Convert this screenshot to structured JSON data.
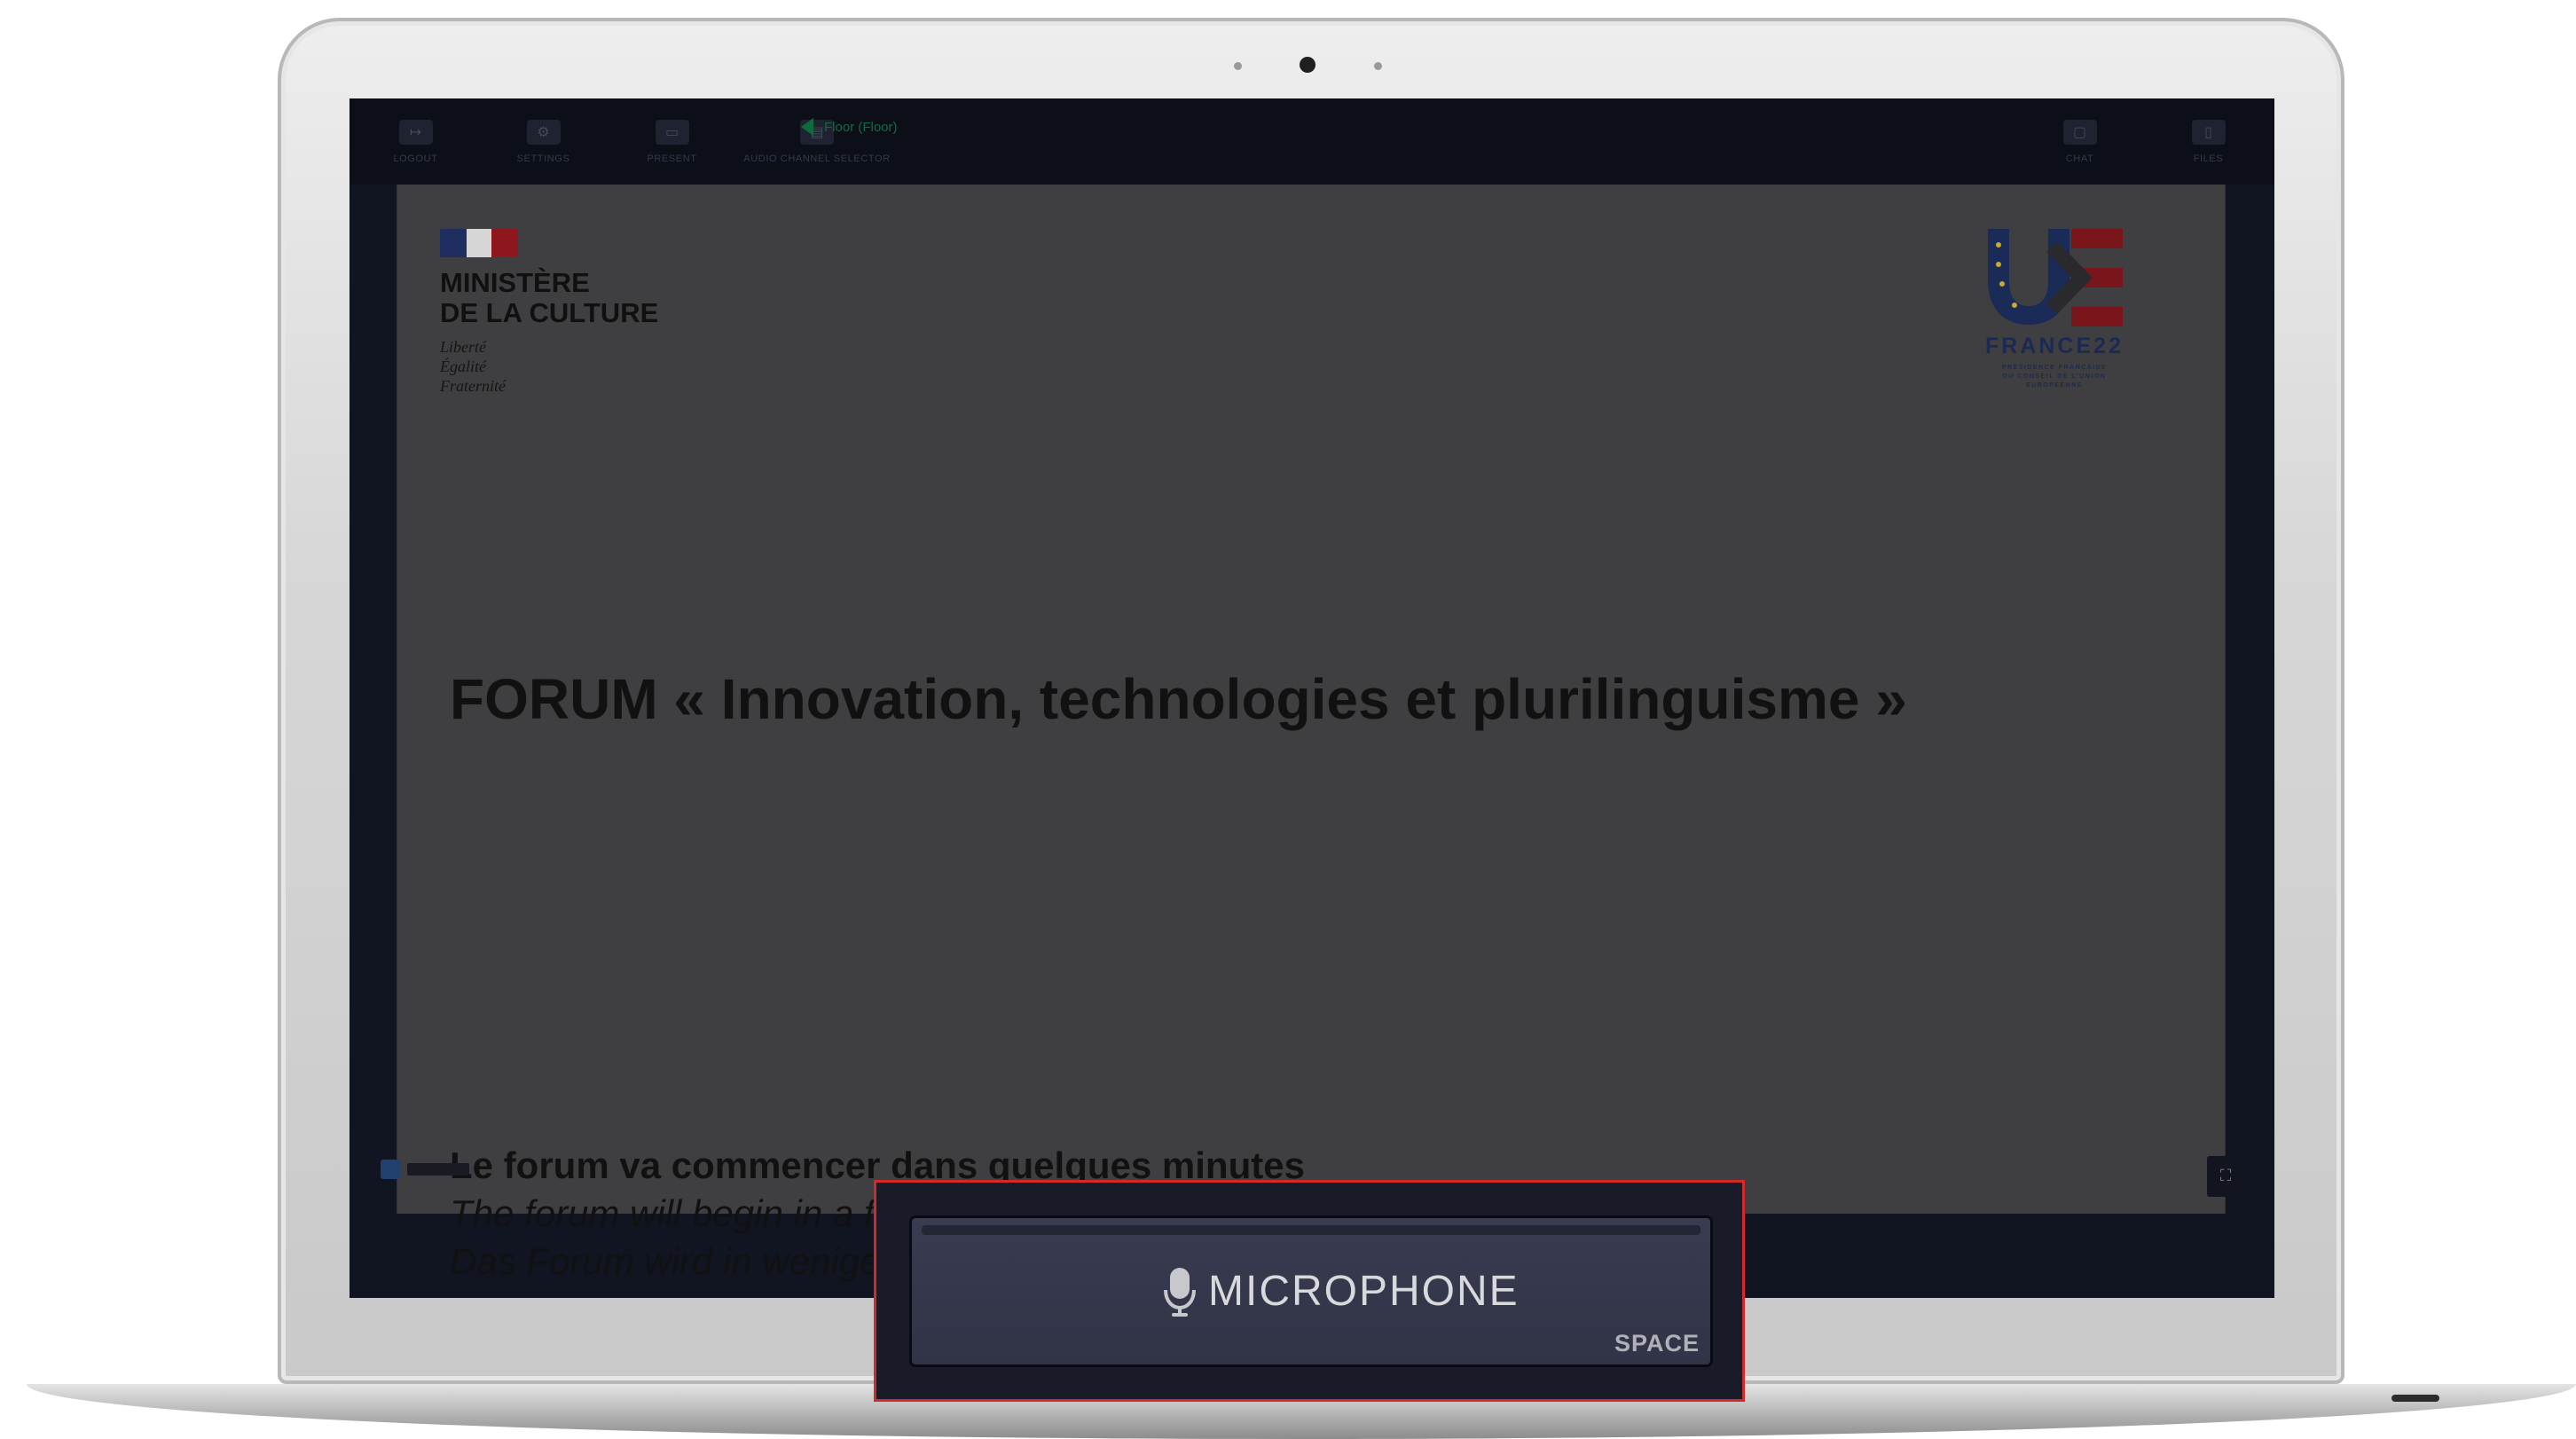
{
  "toolbar": {
    "items": [
      {
        "label": "LOGOUT"
      },
      {
        "label": "SETTINGS"
      },
      {
        "label": "PRESENT"
      },
      {
        "label": "AUDIO CHANNEL SELECTOR"
      },
      {
        "label": "CHAT"
      },
      {
        "label": "FILES"
      }
    ],
    "audio_channel_label": "Floor (Floor)"
  },
  "slide": {
    "ministry": {
      "line1": "MINISTÈRE",
      "line2": "DE LA CULTURE",
      "motto1": "Liberté",
      "motto2": "Égalité",
      "motto3": "Fraternité"
    },
    "eu_presidency": {
      "name": "FRANCE22",
      "sub1": "PRÉSIDENCE FRANÇAISE",
      "sub2": "DU CONSEIL DE L'UNION",
      "sub3": "EUROPÉENNE"
    },
    "title": "FORUM « Innovation, technologies et plurilinguisme »",
    "subtitle_fr": "Le forum va commencer dans quelques minutes",
    "subtitle_en": "The forum will begin in a few minutes",
    "subtitle_de": "Das Forum wird in wenigen Minuten beginnen"
  },
  "microphone": {
    "label": "MICROPHONE",
    "shortcut": "SPACE"
  },
  "colors": {
    "callout_border": "#d22a2a",
    "slide_background": "#3f3f41",
    "toolbar_background": "#0d0f18",
    "mic_button": "#393b50",
    "flag_blue": "#1e2e61",
    "flag_red": "#8e171e"
  },
  "icons": {
    "logout": "logout-icon",
    "settings": "gear-icon",
    "present": "present-icon",
    "audio_selector": "audio-channel-icon",
    "speaker": "speaker-icon",
    "chat": "chat-icon",
    "files": "files-icon",
    "microphone": "microphone-icon",
    "fullscreen": "fullscreen-icon"
  }
}
